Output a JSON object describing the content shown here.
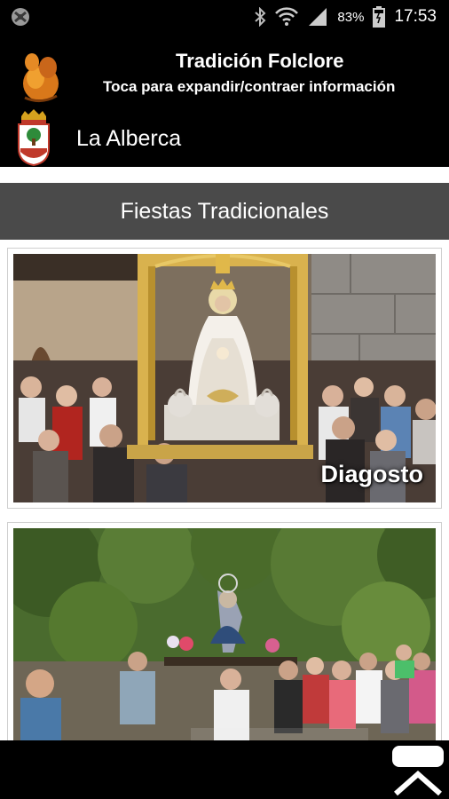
{
  "status_bar": {
    "battery_text": "83%",
    "time": "17:53",
    "icons": [
      "app-icon",
      "bluetooth-icon",
      "wifi-icon",
      "signal-icon",
      "battery-icon"
    ]
  },
  "header": {
    "title": "Tradición Folclore",
    "subtitle": "Toca para expandir/contraer información",
    "town": "La Alberca",
    "logo_icon": "figure-logo",
    "crest_icon": "town-crest"
  },
  "section": {
    "title": "Fiestas Tradicionales"
  },
  "cards": [
    {
      "label": "Diagosto"
    },
    {
      "label": ""
    }
  ],
  "colors": {
    "background": "#ffffff",
    "bars": "#000000",
    "section_header": "#4a4a4a"
  }
}
